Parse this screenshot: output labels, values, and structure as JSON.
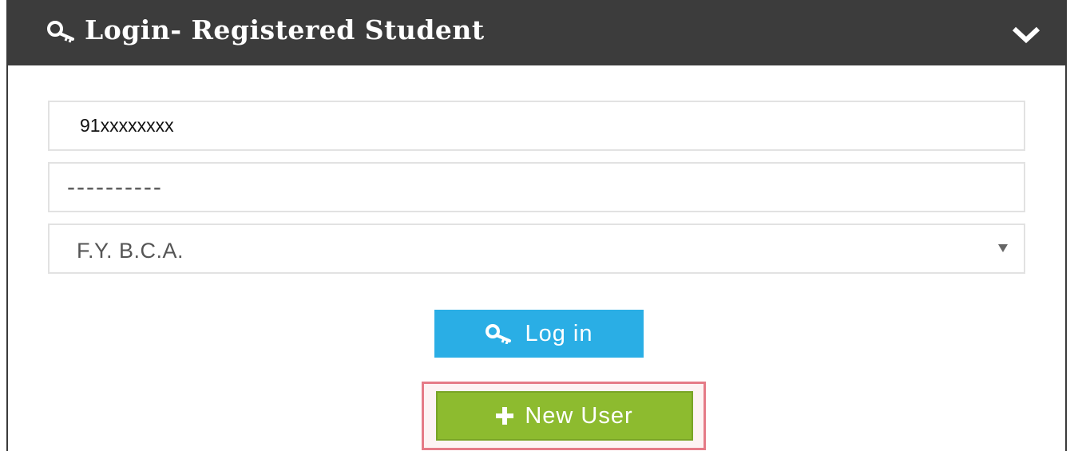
{
  "panel": {
    "title": "Login- Registered Student",
    "title_icon": "key-icon",
    "collapse_icon": "chevron-down-icon"
  },
  "form": {
    "phone_value": "91xxxxxxxx",
    "password_value": "----------",
    "course_selected": "F.Y. B.C.A."
  },
  "buttons": {
    "login_label": "Log in",
    "login_icon": "key-icon",
    "new_user_label": "New User",
    "new_user_icon": "plus-icon"
  },
  "colors": {
    "header_bg": "#3c3c3c",
    "login_button": "#2aaee5",
    "new_user_button": "#8dbb2f",
    "highlight_border": "#e57b87"
  }
}
